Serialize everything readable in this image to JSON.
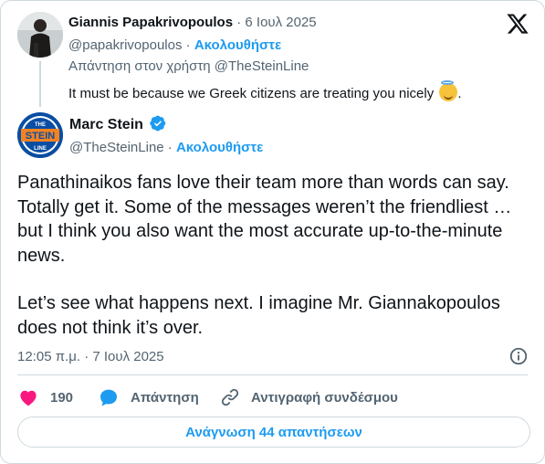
{
  "reply_tweet": {
    "author_name": "Giannis Papakrivopoulos",
    "separator": "·",
    "date": "6 Ιουλ 2025",
    "handle": "@papakrivopoulos",
    "follow_label": "Ακολουθήστε",
    "reply_to": "Απάντηση στον χρήστη @TheSteinLine",
    "text": "It must be because we Greek citizens are treating you nicely",
    "text_end": ".",
    "emoji": "smiling-face-with-halo"
  },
  "main_tweet": {
    "author_name": "Marc Stein",
    "verified": true,
    "handle": "@TheSteinLine",
    "separator": "·",
    "follow_label": "Ακολουθήστε",
    "paragraphs": [
      "Panathinaikos fans love their team more than words can say. Totally get it. Some of the messages weren’t the friendliest … but I think you also want the most accurate up-to-the-minute news.",
      "Let’s see what happens next. I imagine Mr. Giannakopoulos does not think it’s over."
    ],
    "timestamp": "12:05 π.μ. · 7 Ιουλ 2025",
    "avatar_text": [
      "THE",
      "STEIN",
      "LINE"
    ]
  },
  "actions": {
    "likes_count": "190",
    "reply_label": "Απάντηση",
    "copy_link_label": "Αντιγραφή συνδέσμου",
    "read_replies_label": "Ανάγνωση 44 απαντήσεων"
  },
  "colors": {
    "accent": "#1d9bf0",
    "like": "#f91880",
    "muted_text": "#536471",
    "border": "#cfd9de",
    "stein_blue": "#0a4ea3",
    "stein_orange": "#f58220"
  }
}
